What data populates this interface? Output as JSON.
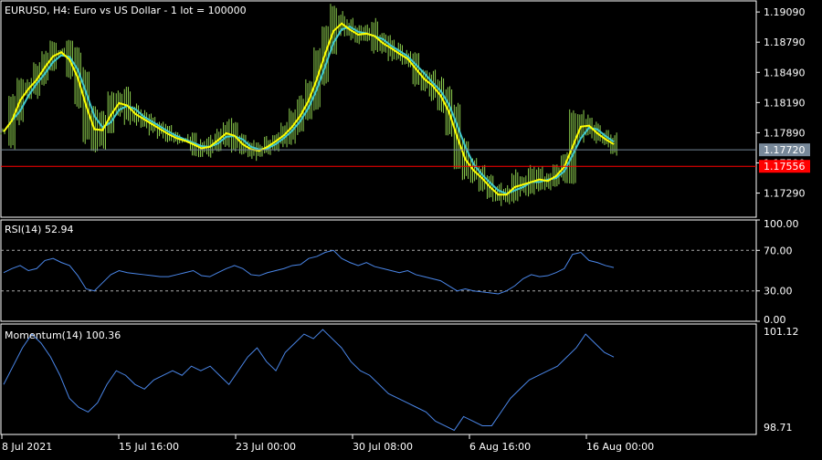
{
  "chart_data": [
    {
      "type": "bar",
      "subtype": "ohlc",
      "title": "EURUSD, H4:  Euro vs US Dollar - 1 lot = 100000",
      "ylim": [
        1.1705,
        1.192
      ],
      "yticks": [
        "1.19090",
        "1.18790",
        "1.18490",
        "1.18190",
        "1.17890",
        "1.17590",
        "1.17290"
      ],
      "ytick_values": [
        1.1909,
        1.1879,
        1.1849,
        1.1819,
        1.1789,
        1.1759,
        1.1729
      ],
      "price_lines": {
        "bid": {
          "value": 1.1772,
          "label": "1.17720",
          "color": "#778899"
        },
        "ask": {
          "value": 1.17556,
          "label": "1.17556",
          "color": "#ff0000"
        }
      },
      "colors": {
        "bars": "#8fd14f",
        "ma_fast": "#ffff00",
        "ma_slow": "#40c8d0"
      },
      "close_series": [
        1.179,
        1.1812,
        1.183,
        1.1835,
        1.1848,
        1.186,
        1.187,
        1.1868,
        1.1855,
        1.1832,
        1.18,
        1.1785,
        1.1798,
        1.1815,
        1.1822,
        1.181,
        1.1805,
        1.18,
        1.1795,
        1.179,
        1.1785,
        1.1782,
        1.178,
        1.1775,
        1.1772,
        1.1778,
        1.1785,
        1.1792,
        1.178,
        1.1775,
        1.177,
        1.1772,
        1.1778,
        1.1783,
        1.179,
        1.18,
        1.1812,
        1.183,
        1.1855,
        1.188,
        1.19,
        1.1895,
        1.1888,
        1.1885,
        1.189,
        1.188,
        1.1876,
        1.187,
        1.1865,
        1.186,
        1.1845,
        1.184,
        1.1832,
        1.182,
        1.18,
        1.177,
        1.1755,
        1.1748,
        1.174,
        1.173,
        1.1725,
        1.173,
        1.174,
        1.1735,
        1.1745,
        1.174,
        1.1742,
        1.175,
        1.176,
        1.179,
        1.18,
        1.1792,
        1.1785,
        1.178,
        1.1775
      ]
    },
    {
      "type": "line",
      "title": "RSI(14) 52.94",
      "ylim": [
        0,
        100
      ],
      "yticks": [
        "100.00",
        "70.00",
        "30.00",
        "0.00"
      ],
      "ytick_values": [
        100,
        70,
        30,
        0
      ],
      "levels": [
        70,
        30
      ],
      "color": "#4a86e8",
      "values": [
        48,
        52,
        55,
        50,
        52,
        60,
        62,
        58,
        55,
        45,
        32,
        30,
        38,
        46,
        50,
        48,
        47,
        46,
        45,
        44,
        44,
        46,
        48,
        50,
        45,
        44,
        48,
        52,
        55,
        52,
        46,
        45,
        48,
        50,
        52,
        55,
        56,
        62,
        64,
        68,
        70,
        62,
        58,
        55,
        58,
        54,
        52,
        50,
        48,
        50,
        46,
        44,
        42,
        40,
        35,
        30,
        32,
        30,
        29,
        28,
        27,
        30,
        35,
        42,
        46,
        44,
        45,
        48,
        52,
        66,
        68,
        60,
        58,
        55,
        53
      ]
    },
    {
      "type": "line",
      "title": "Momentum(14) 100.36",
      "ylim": [
        98.71,
        101.12
      ],
      "yticks": [
        "101.12",
        "98.71"
      ],
      "ytick_values": [
        101.12,
        98.71
      ],
      "color": "#4a86e8",
      "values": [
        99.8,
        100.2,
        100.6,
        100.9,
        100.7,
        100.4,
        100.0,
        99.5,
        99.3,
        99.2,
        99.4,
        99.8,
        100.1,
        100.0,
        99.8,
        99.7,
        99.9,
        100.0,
        100.1,
        100.0,
        100.2,
        100.1,
        100.2,
        100.0,
        99.8,
        100.1,
        100.4,
        100.6,
        100.3,
        100.1,
        100.5,
        100.7,
        100.9,
        100.8,
        101.0,
        100.8,
        100.6,
        100.3,
        100.1,
        100.0,
        99.8,
        99.6,
        99.5,
        99.4,
        99.3,
        99.2,
        99.0,
        98.9,
        98.8,
        99.1,
        99.0,
        98.9,
        98.9,
        99.2,
        99.5,
        99.7,
        99.9,
        100.0,
        100.1,
        100.2,
        100.4,
        100.6,
        100.9,
        100.7,
        100.5,
        100.4
      ]
    }
  ],
  "xaxis": {
    "labels": [
      "8 Jul 2021",
      "15 Jul 16:00",
      "23 Jul 00:00",
      "30 Jul 08:00",
      "6 Aug 16:00",
      "16 Aug 00:00"
    ]
  }
}
